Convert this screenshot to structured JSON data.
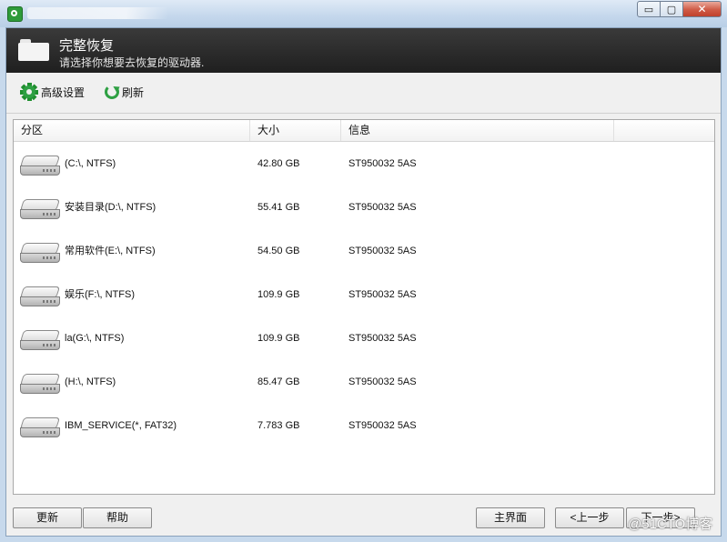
{
  "window": {
    "close_label": "✕",
    "min_label": "▭",
    "max_label": "▢"
  },
  "header": {
    "title": "完整恢复",
    "subtitle": "请选择你想要去恢复的驱动器."
  },
  "toolbar": {
    "advanced_label": "高级设置",
    "refresh_label": "刷新"
  },
  "list": {
    "columns": [
      "分区",
      "大小",
      "信息"
    ],
    "rows": [
      {
        "partition": "(C:\\, NTFS)",
        "size": "42.80 GB",
        "info": "ST950032 5AS"
      },
      {
        "partition": "安装目录(D:\\, NTFS)",
        "size": "55.41 GB",
        "info": "ST950032 5AS"
      },
      {
        "partition": "常用软件(E:\\, NTFS)",
        "size": "54.50 GB",
        "info": "ST950032 5AS"
      },
      {
        "partition": "娱乐(F:\\, NTFS)",
        "size": "109.9 GB",
        "info": "ST950032 5AS"
      },
      {
        "partition": "la(G:\\, NTFS)",
        "size": "109.9 GB",
        "info": "ST950032 5AS"
      },
      {
        "partition": "(H:\\, NTFS)",
        "size": "85.47 GB",
        "info": "ST950032 5AS"
      },
      {
        "partition": "IBM_SERVICE(*, FAT32)",
        "size": "7.783 GB",
        "info": "ST950032 5AS"
      }
    ]
  },
  "buttons": {
    "update": "更新",
    "help": "帮助",
    "main": "主界面",
    "prev": "<上一步",
    "next": "下一步>"
  },
  "watermark": "@51CTO博客",
  "colors": {
    "accent_green": "#2ea043",
    "header_bg": "#262626"
  }
}
